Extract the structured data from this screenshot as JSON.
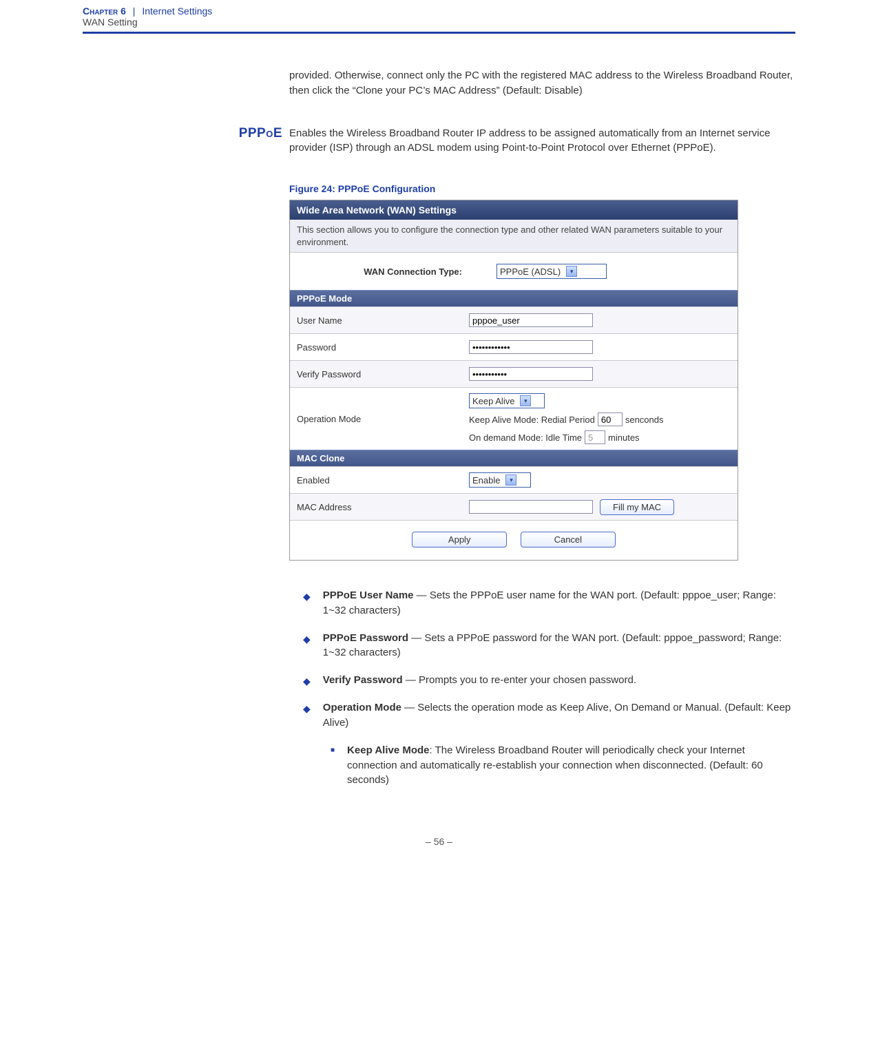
{
  "header": {
    "chapter": "Chapter 6",
    "title": "Internet Settings",
    "sub": "WAN Setting"
  },
  "intro_cont": "provided. Otherwise, connect only the PC with the registered MAC address to the Wireless Broadband Router, then click the “Clone your PC’s MAC Address” (Default: Disable)",
  "section": {
    "heading": "PPPoE",
    "text": "Enables the Wireless Broadband Router IP address to be assigned automatically from an Internet service provider (ISP) through an ADSL modem using Point-to-Point Protocol over Ethernet (PPPoE).",
    "fig_caption": "Figure 24:  PPPoE Configuration"
  },
  "screenshot": {
    "title": "Wide Area Network (WAN) Settings",
    "desc": "This section allows you to configure the connection type and other related WAN parameters suitable to your environment.",
    "wan_label": "WAN Connection Type:",
    "wan_value": "PPPoE (ADSL)",
    "pppoe_header": "PPPoE Mode",
    "user_label": "User Name",
    "user_value": "pppoe_user",
    "pass_label": "Password",
    "pass_value": "••••••••••••",
    "verify_label": "Verify Password",
    "verify_value": "•••••••••••",
    "opmode_label": "Operation Mode",
    "opmode_value": "Keep Alive",
    "keepalive_text_a": "Keep Alive Mode: Redial Period",
    "keepalive_val": "60",
    "keepalive_text_b": "senconds",
    "ondemand_text_a": "On demand Mode: Idle Time",
    "ondemand_val": "5",
    "ondemand_text_b": "minutes",
    "macclone_header": "MAC Clone",
    "enabled_label": "Enabled",
    "enabled_value": "Enable",
    "macaddr_label": "MAC Address",
    "macaddr_value": "",
    "fill_btn": "Fill my MAC",
    "apply": "Apply",
    "cancel": "Cancel"
  },
  "bullets": {
    "b1_label": "PPPoE User Name",
    "b1_text": " — Sets the PPPoE user name for the WAN port. (Default: pppoe_user; Range: 1~32 characters)",
    "b2_label": "PPPoE Password",
    "b2_text": " — Sets a PPPoE password for the WAN port. (Default: pppoe_password; Range: 1~32 characters)",
    "b3_label": "Verify Password",
    "b3_text": " — Prompts you to re-enter your chosen password.",
    "b4_label": "Operation Mode",
    "b4_text": " — Selects the operation mode as Keep Alive, On Demand or Manual. (Default: Keep Alive)",
    "s1_label": "Keep Alive Mode",
    "s1_text": ": The Wireless Broadband Router will periodically check your Internet connection and automatically re-establish your connection when disconnected. (Default: 60 seconds)"
  },
  "page_number": "–  56  –"
}
